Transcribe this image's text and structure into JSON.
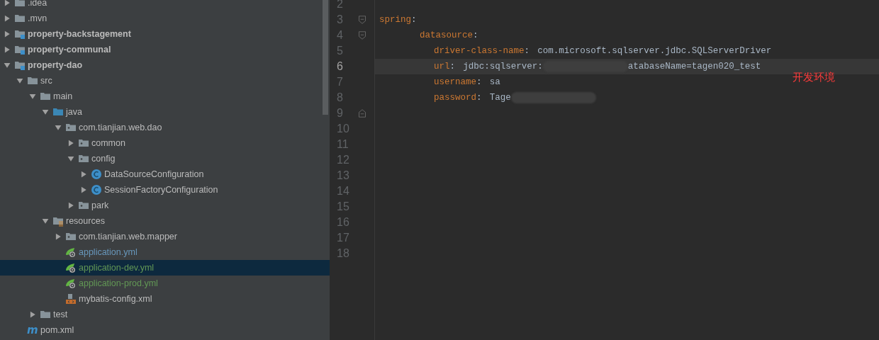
{
  "project_tree": [
    {
      "label": ".idea",
      "kind": "folder",
      "expanded": false,
      "selected": false
    },
    {
      "label": ".mvn",
      "kind": "folder",
      "expanded": false,
      "selected": false
    },
    {
      "label": "property-backstagement",
      "kind": "module",
      "expanded": false,
      "selected": false
    },
    {
      "label": "property-communal",
      "kind": "module",
      "expanded": false,
      "selected": false
    },
    {
      "label": "property-dao",
      "kind": "module",
      "expanded": true,
      "selected": false,
      "children": [
        {
          "label": "src",
          "kind": "folder",
          "expanded": true,
          "selected": false,
          "children": [
            {
              "label": "main",
              "kind": "folder",
              "expanded": true,
              "selected": false,
              "children": [
                {
                  "label": "java",
                  "kind": "source",
                  "expanded": true,
                  "selected": false,
                  "children": [
                    {
                      "label": "com.tianjian.web.dao",
                      "kind": "package",
                      "expanded": true,
                      "selected": false,
                      "children": [
                        {
                          "label": "common",
                          "kind": "package",
                          "expanded": false,
                          "selected": false
                        },
                        {
                          "label": "config",
                          "kind": "package",
                          "expanded": true,
                          "selected": false,
                          "children": [
                            {
                              "label": "DataSourceConfiguration",
                              "kind": "class",
                              "expanded": false,
                              "selected": false
                            },
                            {
                              "label": "SessionFactoryConfiguration",
                              "kind": "class",
                              "expanded": false,
                              "selected": false
                            }
                          ]
                        },
                        {
                          "label": "park",
                          "kind": "package",
                          "expanded": false,
                          "selected": false
                        }
                      ]
                    }
                  ]
                },
                {
                  "label": "resources",
                  "kind": "resources",
                  "expanded": true,
                  "selected": false,
                  "children": [
                    {
                      "label": "com.tianjian.web.mapper",
                      "kind": "package",
                      "expanded": false,
                      "selected": false
                    },
                    {
                      "label": "application.yml",
                      "kind": "yml",
                      "selected": false,
                      "color": "#6897bb"
                    },
                    {
                      "label": "application-dev.yml",
                      "kind": "yml",
                      "selected": true,
                      "color": "#629755"
                    },
                    {
                      "label": "application-prod.yml",
                      "kind": "yml",
                      "selected": false,
                      "color": "#629755"
                    },
                    {
                      "label": "mybatis-config.xml",
                      "kind": "xml",
                      "selected": false
                    }
                  ]
                }
              ]
            },
            {
              "label": "test",
              "kind": "folder",
              "expanded": false,
              "selected": false
            }
          ]
        },
        {
          "label": "pom.xml",
          "kind": "pom",
          "badge": "m",
          "selected": false
        }
      ]
    }
  ],
  "editor": {
    "line_numbers": [
      {
        "num": "2",
        "current": false
      },
      {
        "num": "3",
        "current": false,
        "fold_start": true
      },
      {
        "num": "4",
        "current": false,
        "fold_start": true
      },
      {
        "num": "5",
        "current": false
      },
      {
        "num": "6",
        "current": true
      },
      {
        "num": "7",
        "current": false
      },
      {
        "num": "8",
        "current": false
      },
      {
        "num": "9",
        "current": false,
        "fold_end": true
      },
      {
        "num": "10",
        "current": false
      },
      {
        "num": "11",
        "current": false
      },
      {
        "num": "12",
        "current": false
      },
      {
        "num": "13",
        "current": false
      },
      {
        "num": "14",
        "current": false
      },
      {
        "num": "15",
        "current": false
      },
      {
        "num": "16",
        "current": false
      },
      {
        "num": "17",
        "current": false
      },
      {
        "num": "18",
        "current": false
      }
    ],
    "code": [
      {
        "key": "spring",
        "sep": ":",
        "current": false,
        "children": [
          {
            "key": "datasource",
            "sep": ":",
            "current": false,
            "children": [
              {
                "key": "driver-class-name",
                "sep": ":",
                "current": false,
                "value": "com.microsoft.sqlserver.jdbc.SQLServerDriver"
              },
              {
                "key": "url",
                "sep": ":",
                "current": true,
                "value": "jdbc:sqlserver:",
                "redacted": true,
                "value_after": "atabaseName=tagen020_test"
              },
              {
                "key": "username",
                "sep": ":",
                "current": false,
                "value": "sa"
              },
              {
                "key": "password",
                "sep": ":",
                "current": false,
                "value": "Tage",
                "redacted": true
              }
            ]
          }
        ]
      }
    ],
    "annotation": "开发环境"
  }
}
